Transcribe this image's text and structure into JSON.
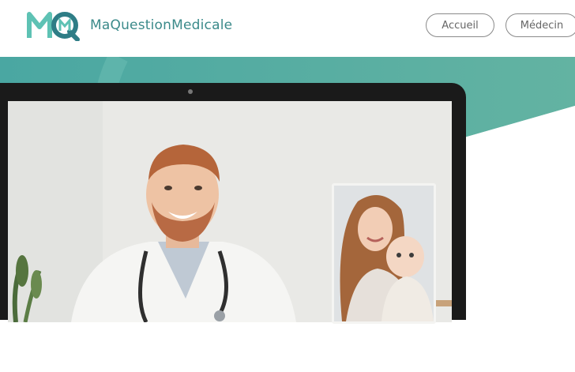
{
  "header": {
    "brand_name": "MaQuestionMedicale",
    "logo_letters": "MQ",
    "nav": [
      {
        "label": "Accueil"
      },
      {
        "label": "Médecin"
      }
    ]
  },
  "colors": {
    "brand_teal": "#3b8a8a",
    "hero_teal": "#5aafa3",
    "logo_light_teal": "#5ec2b4",
    "logo_dark_teal": "#2e7d86"
  },
  "hero": {
    "image": "video-consultation-laptop",
    "main_video": "smiling-doctor-with-stethoscope",
    "pip_video": "mother-holding-baby"
  }
}
